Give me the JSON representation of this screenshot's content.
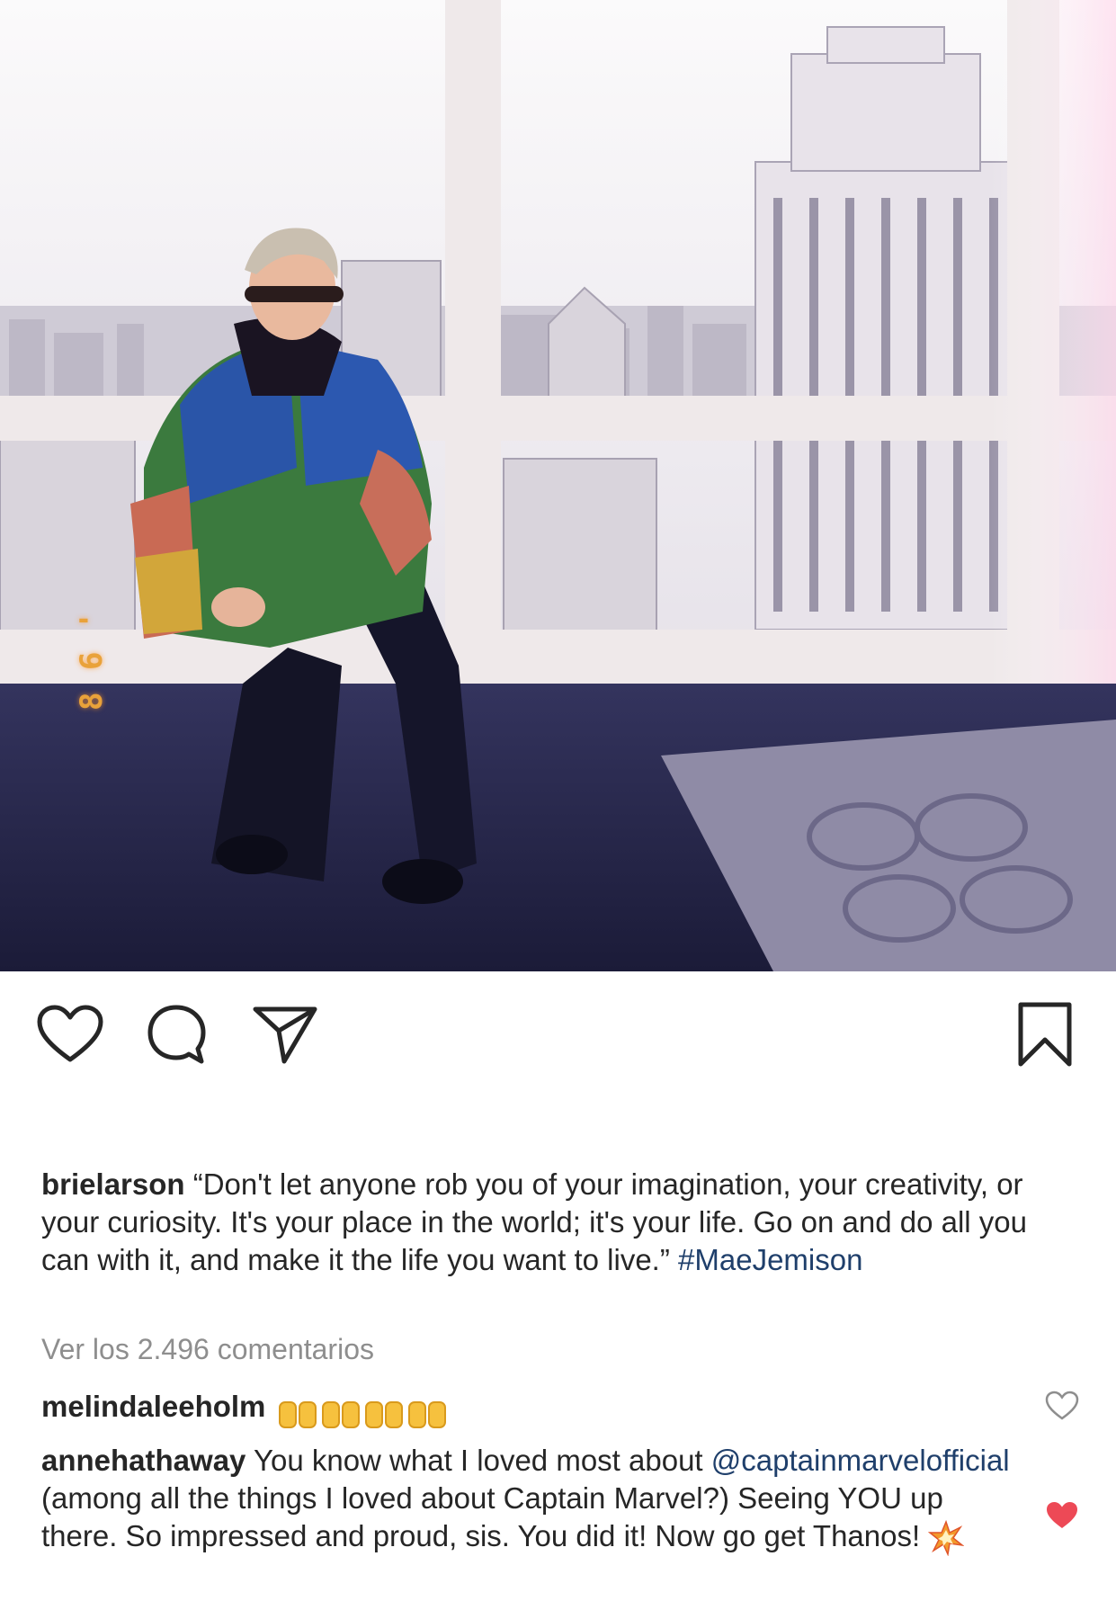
{
  "post": {
    "image": {
      "alt_icon": "photo-woman-city-window",
      "film_date_stamp": "8 6 '",
      "colors": {
        "sky": "#f7f4f6",
        "floor": "#1e1e3c",
        "frame": "#efe8ea"
      }
    },
    "actions": {
      "like_icon": "heart-outline-icon",
      "comment_icon": "comment-bubble-icon",
      "share_icon": "paper-plane-icon",
      "save_icon": "bookmark-icon"
    },
    "caption": {
      "username": "brielarson",
      "text": "“Don't let anyone rob you of your imagination, your creativity, or your curiosity. It's your place in the world; it's your life. Go on and do all you can with it, and make it the life you want to live.”",
      "hashtag": "#MaeJemison"
    },
    "view_comments": "Ver los 2.496 comentarios",
    "comments": [
      {
        "username": "melindaleeholm",
        "text": "",
        "emoji": "raising-hands-emoji x4",
        "liked": false
      },
      {
        "username": "annehathaway",
        "text_before": "You know what I loved most about",
        "mention": "@captainmarvelofficial",
        "text_after": "(among all the things I loved about Captain Marvel?) Seeing YOU up there.  So impressed and proud, sis.  You did it!  Now go get Thanos!",
        "emoji": "collision-emoji",
        "liked": true
      }
    ],
    "colors": {
      "link": "#1f3f6b",
      "muted": "#8e8e8e",
      "liked": "#ed4956",
      "text": "#262626"
    }
  }
}
